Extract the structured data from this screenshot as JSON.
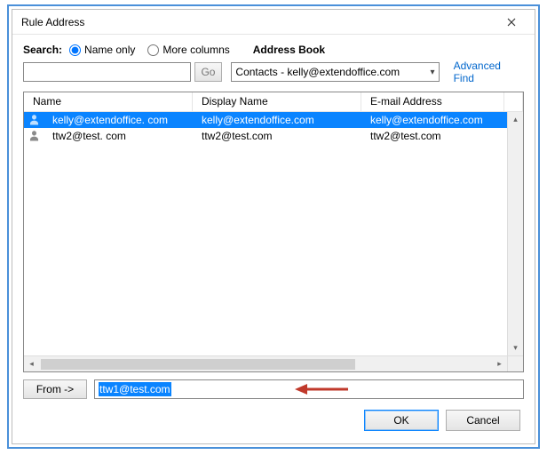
{
  "window": {
    "title": "Rule Address",
    "close_icon": "close"
  },
  "search": {
    "label": "Search:",
    "radio_name_only": "Name only",
    "radio_more_columns": "More columns",
    "selected": "name_only",
    "input_value": "",
    "go_label": "Go"
  },
  "address_book": {
    "label": "Address Book",
    "selected": "Contacts - kelly@extendoffice.com",
    "advanced_find": "Advanced Find"
  },
  "list": {
    "headers": {
      "name": "Name",
      "display": "Display Name",
      "email": "E-mail Address"
    },
    "rows": [
      {
        "name": "kelly@extendoffice. com",
        "display": "kelly@extendoffice.com",
        "email": "kelly@extendoffice.com",
        "selected": true
      },
      {
        "name": "ttw2@test. com",
        "display": "ttw2@test.com",
        "email": "ttw2@test.com",
        "selected": false
      }
    ]
  },
  "from": {
    "button_label": "From ->",
    "value": "ttw1@test.com"
  },
  "footer": {
    "ok": "OK",
    "cancel": "Cancel"
  },
  "colors": {
    "selection": "#0a84ff",
    "link": "#0066cc",
    "arrow": "#c0392b"
  }
}
